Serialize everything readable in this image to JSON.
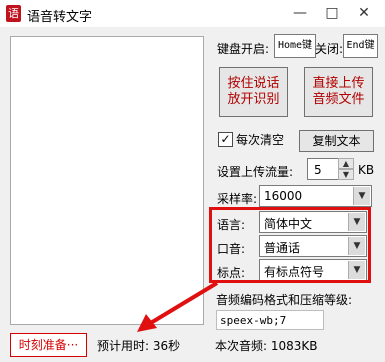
{
  "window": {
    "title": "语音转文字",
    "icon_glyph": "语"
  },
  "hotkey": {
    "start_label": "键盘开启:",
    "start_value": "Home键",
    "stop_label": "关闭:",
    "stop_value": "End键"
  },
  "buttons": {
    "hold_to_talk": "按住说话放开识别",
    "upload_audio": "直接上传音频文件",
    "copy_text": "复制文本"
  },
  "clear_each": {
    "label": "每次清空",
    "checked": true
  },
  "upload": {
    "label": "设置上传流量:",
    "value": "5",
    "unit": "KB"
  },
  "sample_rate": {
    "label": "采样率:",
    "value": "16000"
  },
  "language": {
    "label": "语言:",
    "value": "简体中文"
  },
  "accent": {
    "label": "口音:",
    "value": "普通话"
  },
  "punctuation": {
    "label": "标点:",
    "value": "有标点符号"
  },
  "codec": {
    "label": "音频编码格式和压缩等级:",
    "value": "speex-wb;7"
  },
  "status": {
    "button": "时刻准备···",
    "elapsed": "预计用时: 36秒",
    "audio": "本次音频: 1083KB"
  },
  "colors": {
    "accent_red": "#e01010"
  }
}
